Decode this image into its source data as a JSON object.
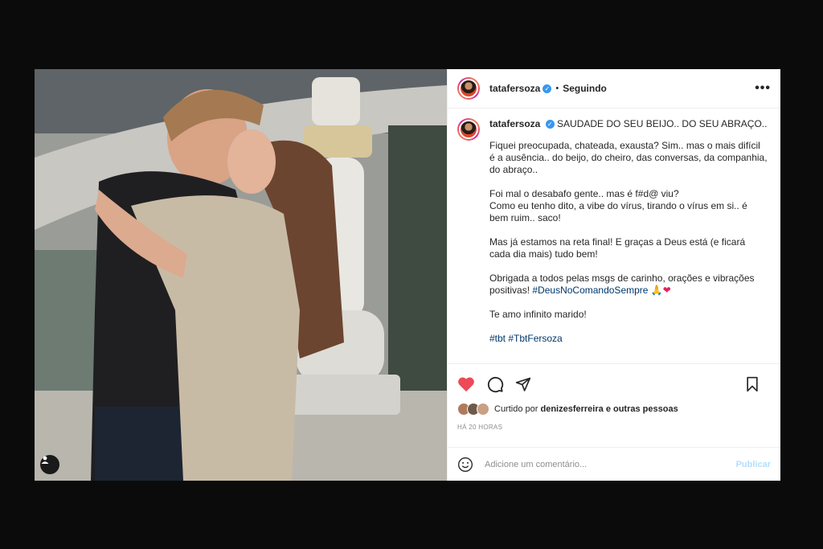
{
  "post": {
    "username": "tatafersoza",
    "follow_status": "Seguindo",
    "more_icon": "more-options-icon",
    "caption_first": "SAUDADE DO SEU BEIJO.. DO SEU ABRAÇO..",
    "caption_paragraphs": [
      "Fiquei preocupada, chateada, exausta? Sim.. mas o mais difícil é a ausência.. do beijo, do cheiro, das conversas, da companhia, do abraço..",
      "Foi mal o desabafo gente.. mas é f#d@ viu?\nComo eu tenho dito, a vibe do vírus, tirando o vírus em si.. é bem ruim.. saco!",
      "Mas já estamos na reta final! E graças a Deus está (e ficará cada dia mais) tudo bem!",
      "Obrigada a todos pelas msgs de carinho, orações e vibrações positivas!",
      "Te amo infinito marido!"
    ],
    "caption_hashtag_inline": "#DeusNoComandoSempre",
    "caption_emoji": "🙏",
    "caption_heart": "❤",
    "hashtags": "#tbt #TbtFersoza",
    "likes_prefix": "Curtido por",
    "likes_user": "denizesferreira",
    "likes_suffix": "e outras pessoas",
    "time": "HÁ 20 HORAS",
    "comment_placeholder": "Adicione um comentário...",
    "publish_label": "Publicar"
  },
  "colors": {
    "like_red": "#ed4956",
    "hashtag_blue": "#00376b",
    "publish_blue": "#b2dffc",
    "verified_blue": "#3897f0"
  }
}
